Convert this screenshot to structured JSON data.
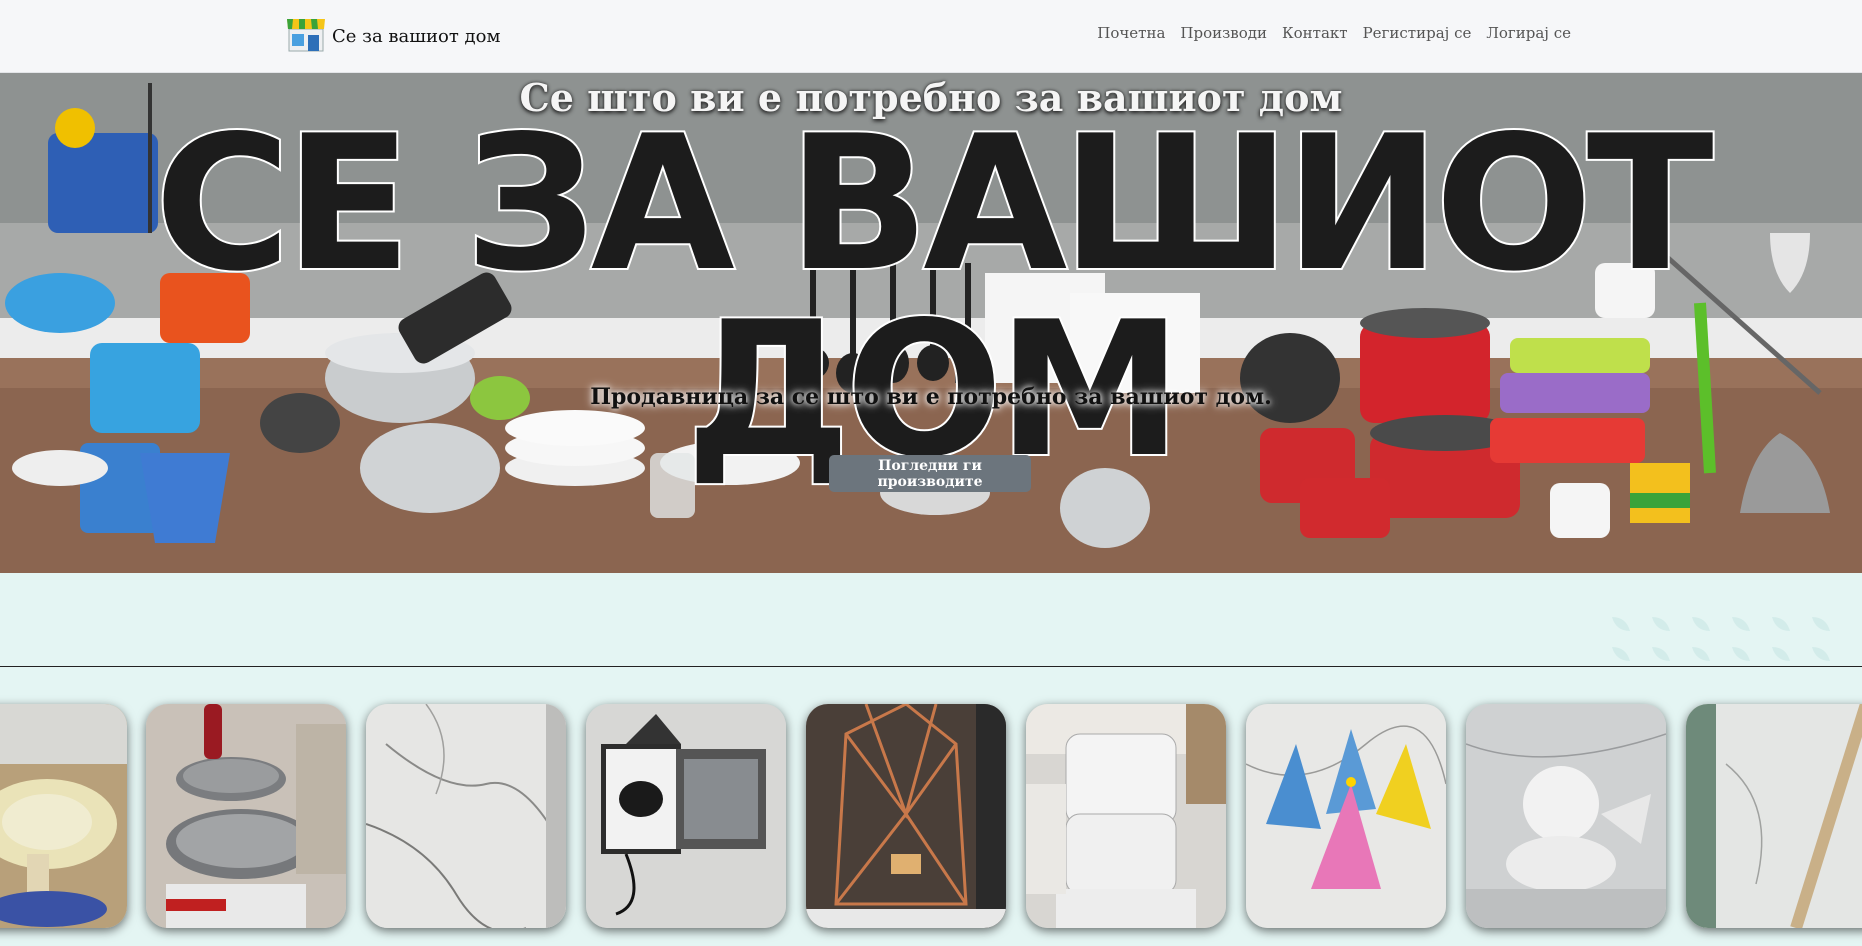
{
  "navbar": {
    "brand": "Се за вашиот дом",
    "links": [
      "Почетна",
      "Производи",
      "Контакт",
      "Регистирај се",
      "Логирај се"
    ]
  },
  "hero": {
    "tagline": "Се што ви е потребно за вашиот дом",
    "title": "СЕ ЗА ВАШИОТ ДОМ",
    "subtitle": "Продавница за се што ви е потребно за вашиот дом.",
    "button": "Погледни ги производите"
  },
  "carousel": {
    "items": [
      {
        "label": "product-photo-dishes"
      },
      {
        "label": "product-photo-pans"
      },
      {
        "label": "product-photo-marble-panel"
      },
      {
        "label": "product-photo-gift-box"
      },
      {
        "label": "product-photo-copper-lantern"
      },
      {
        "label": "product-photo-glass-mugs"
      },
      {
        "label": "product-photo-party-hats"
      },
      {
        "label": "product-photo-angel-statue"
      },
      {
        "label": "product-photo-marble-tiles"
      }
    ]
  },
  "colors": {
    "navbar_bg": "#f6f7f9",
    "page_bg": "#e4f5f3",
    "button_bg": "#6c757d"
  }
}
